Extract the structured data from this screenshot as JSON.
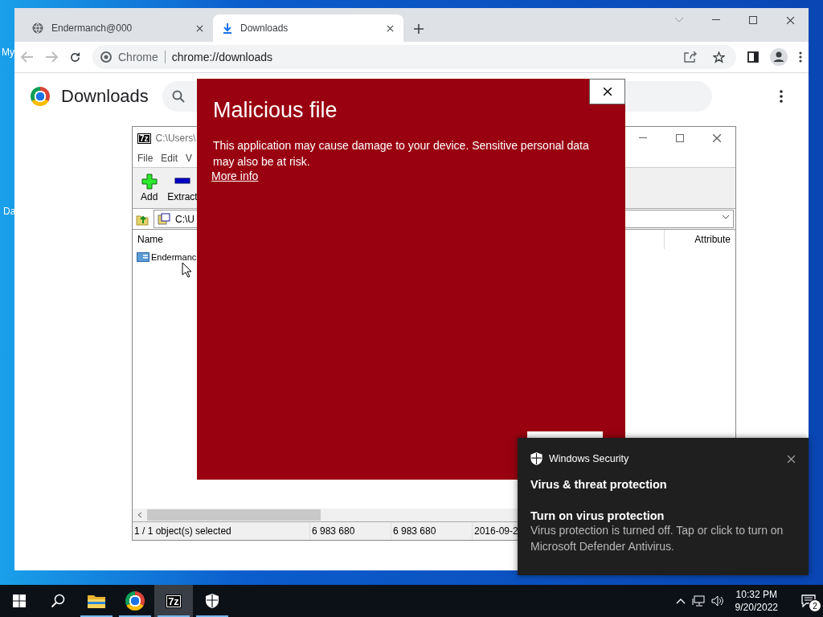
{
  "desktop": {
    "icons": [
      {
        "label": "My"
      },
      {
        "label": "Da"
      }
    ]
  },
  "browser": {
    "tabs": [
      {
        "title": "Endermanch@000",
        "kind": "globe",
        "selected": false
      },
      {
        "title": "Downloads",
        "kind": "download",
        "selected": true
      }
    ],
    "omnibox": {
      "chip": "Chrome",
      "url": "chrome://downloads"
    },
    "page_title": "Downloads"
  },
  "archiver": {
    "icon_text": "7z",
    "title": "C:\\Users\\",
    "menu": [
      "File",
      "Edit",
      "V"
    ],
    "tools": [
      {
        "label": "Add",
        "kind": "add"
      },
      {
        "label": "Extract",
        "kind": "extract"
      }
    ],
    "path": "C:\\U",
    "columns": [
      "Name",
      "Attribute"
    ],
    "rows": [
      {
        "name": "Endermanc"
      }
    ],
    "status": [
      "1 / 1 object(s) selected",
      "6 983 680",
      "6 983 680",
      "2016-09-2"
    ]
  },
  "dialog": {
    "title": "Malicious file",
    "message": "This application may cause damage to your device. Sensitive personal data may also be at risk.",
    "link": "More info"
  },
  "toast": {
    "app": "Windows Security",
    "heading": "Virus & threat protection",
    "title": "Turn on virus protection",
    "body": "Virus protection is turned off. Tap or click to turn on Microsoft Defender Antivirus."
  },
  "taskbar": {
    "apps": [
      {
        "kind": "start",
        "running": false,
        "selected": false
      },
      {
        "kind": "search",
        "running": false,
        "selected": false
      },
      {
        "kind": "folder",
        "running": true,
        "selected": false
      },
      {
        "kind": "browser",
        "running": true,
        "selected": false
      },
      {
        "kind": "archiver",
        "label": "7z",
        "running": true,
        "selected": true
      },
      {
        "kind": "shield",
        "running": true,
        "selected": false
      }
    ],
    "time": "10:32 PM",
    "date": "9/20/2022",
    "notifications": "2"
  }
}
